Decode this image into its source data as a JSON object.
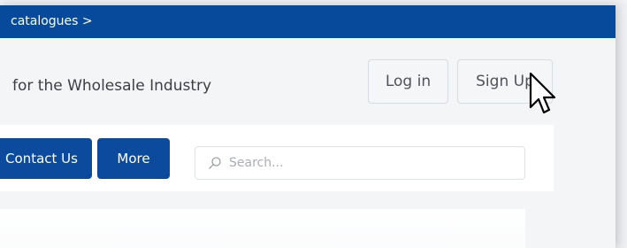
{
  "banner": {
    "link_text": "catalogues >"
  },
  "header": {
    "tagline": "for the Wholesale Industry",
    "login_label": "Log in",
    "signup_label": "Sign Up"
  },
  "nav": {
    "contact_label": "Contact Us",
    "more_label": "More"
  },
  "search": {
    "placeholder": "Search...",
    "value": "",
    "icon": "search-icon"
  },
  "cursor": {
    "icon": "arrow-cursor-icon"
  },
  "colors": {
    "brand_blue": "#074a9c",
    "background": "#f4f5f7"
  }
}
